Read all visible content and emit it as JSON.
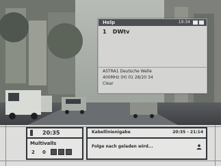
{
  "info_panel": {
    "title": "Help",
    "time": "19:34",
    "channel_number": "1",
    "channel_name": "DWtv",
    "line1": "ASTRA1 Deutsche Welle",
    "line2": "400MHz (H) 01 28/20 34",
    "line3": "Clear"
  },
  "status_bar": {
    "clock": "20:35",
    "channel_label": "Multivalls",
    "num1": "2",
    "num2": "0",
    "current_event_title": "Kabellinienigabe",
    "current_event_time": "20:35 - 21:14",
    "next_event_title": "Folge nach geladen wird..."
  },
  "colors": {
    "panel_bg": "#d4d5d2",
    "titlebar": "#4b4e52",
    "bar_bg": "#dedfdc"
  }
}
